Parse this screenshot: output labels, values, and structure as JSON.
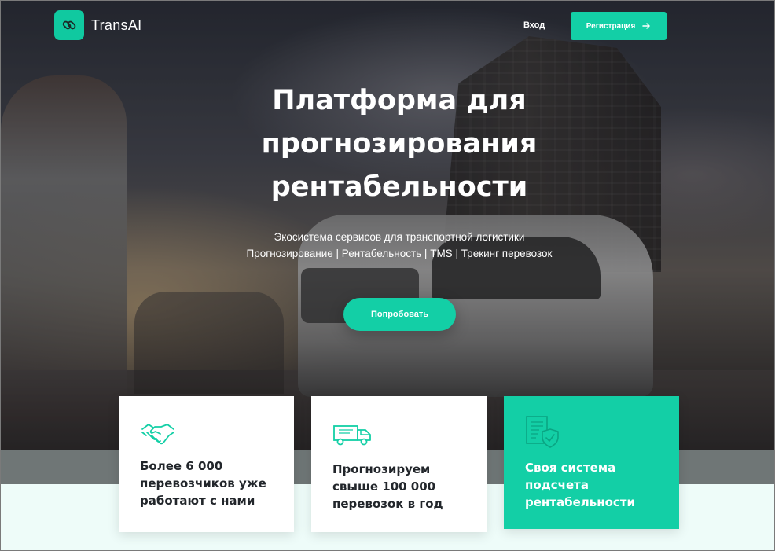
{
  "header": {
    "logo_text": "TransAI",
    "logo_icon": "link-icon",
    "login_label": "Вход",
    "register_label": "Регистрация",
    "register_icon": "arrow-right-icon"
  },
  "hero": {
    "title": "Платформа для прогнозирования рентабельности",
    "subtitle_line1": "Экосистема сервисов для транспортной логистики",
    "subtitle_line2": "Прогнозирование | Рентабельность | TMS | Трекинг перевозок",
    "cta_label": "Попробовать"
  },
  "cards": [
    {
      "icon": "handshake-icon",
      "text": "Более 6 000 перевозчиков уже работают с нами"
    },
    {
      "icon": "truck-icon",
      "text": "Прогнозируем свыше 100 000 перевозок в год"
    },
    {
      "icon": "document-shield-icon",
      "text": "Своя система подсчета рентабельности"
    }
  ],
  "colors": {
    "accent": "#13cfa6",
    "text_dark": "#22262b",
    "light_bg": "#eefcf9"
  }
}
